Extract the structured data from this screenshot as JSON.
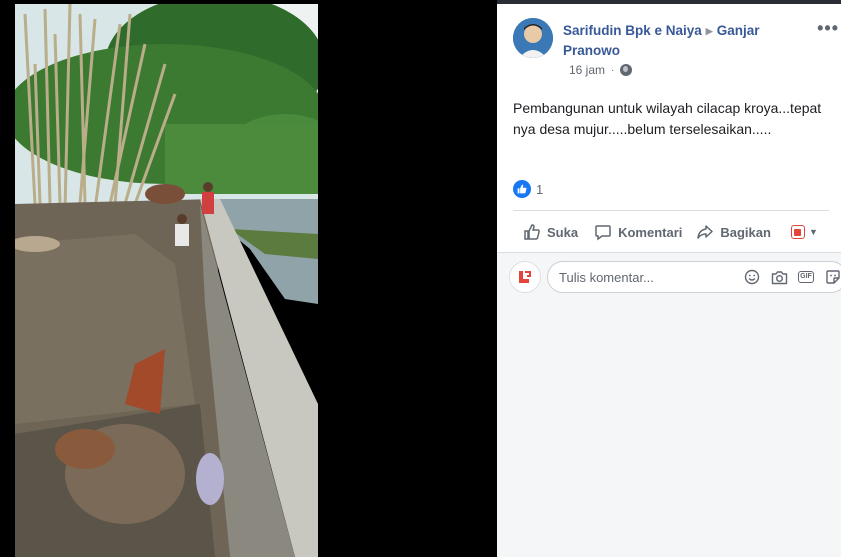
{
  "post": {
    "author": "Sarifudin Bpk e Naiya",
    "target": "Ganjar Pranowo",
    "time": "16 jam",
    "text": "Pembangunan untuk wilayah cilacap kroya...tepat nya desa mujur.....belum terselesaikan.....",
    "like_count": "1",
    "more_icon": "ellipsis-icon",
    "privacy_icon": "globe-icon"
  },
  "actions": {
    "like": "Suka",
    "comment": "Komentari",
    "share": "Bagikan"
  },
  "comment": {
    "placeholder": "Tulis komentar...",
    "icons": [
      "emoji-icon",
      "camera-icon",
      "gif-icon",
      "sticker-icon"
    ]
  },
  "colors": {
    "link": "#385898",
    "like_blue": "#1877f2",
    "brand_red": "#e4453a"
  }
}
